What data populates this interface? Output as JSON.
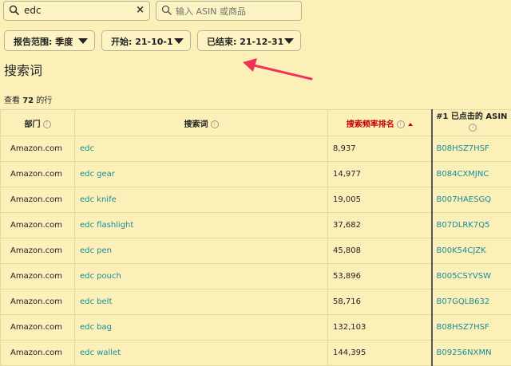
{
  "search": {
    "value": "edc",
    "clear_label": "×"
  },
  "asin_search": {
    "placeholder": "输入 ASIN 或商品"
  },
  "filters": {
    "range_label": "报告范围: 季度",
    "start_label": "开始: 21-10-1",
    "end_label": "已结束: 21-12-31"
  },
  "page_title": "搜索词",
  "row_count": {
    "prefix": "查看 ",
    "count": "72",
    "suffix": " 的行"
  },
  "table": {
    "headers": {
      "dept": "部门",
      "term": "搜索词",
      "rank": "搜索频率排名",
      "asin": "#1 已点击的 ASIN"
    },
    "rows": [
      {
        "dept": "Amazon.com",
        "term": "edc",
        "rank": "8,937",
        "asin": "B08HSZ7HSF"
      },
      {
        "dept": "Amazon.com",
        "term": "edc gear",
        "rank": "14,977",
        "asin": "B084CXMJNC"
      },
      {
        "dept": "Amazon.com",
        "term": "edc knife",
        "rank": "19,005",
        "asin": "B007HAESGQ"
      },
      {
        "dept": "Amazon.com",
        "term": "edc flashlight",
        "rank": "37,682",
        "asin": "B07DLRK7Q5"
      },
      {
        "dept": "Amazon.com",
        "term": "edc pen",
        "rank": "45,808",
        "asin": "B00K54CJZK"
      },
      {
        "dept": "Amazon.com",
        "term": "edc pouch",
        "rank": "53,896",
        "asin": "B005CSYVSW"
      },
      {
        "dept": "Amazon.com",
        "term": "edc belt",
        "rank": "58,716",
        "asin": "B07GQLB632"
      },
      {
        "dept": "Amazon.com",
        "term": "edc bag",
        "rank": "132,103",
        "asin": "B08HSZ7HSF"
      },
      {
        "dept": "Amazon.com",
        "term": "edc wallet",
        "rank": "144,395",
        "asin": "B09256NXMN"
      }
    ]
  },
  "colors": {
    "background": "#fbf1b8",
    "link": "#1a8a9a",
    "sorted": "#c40000",
    "arrow": "#f0325a"
  },
  "icons": [
    "search-icon",
    "close-icon",
    "chevron-down-icon",
    "info-icon",
    "sort-ascending-icon"
  ]
}
